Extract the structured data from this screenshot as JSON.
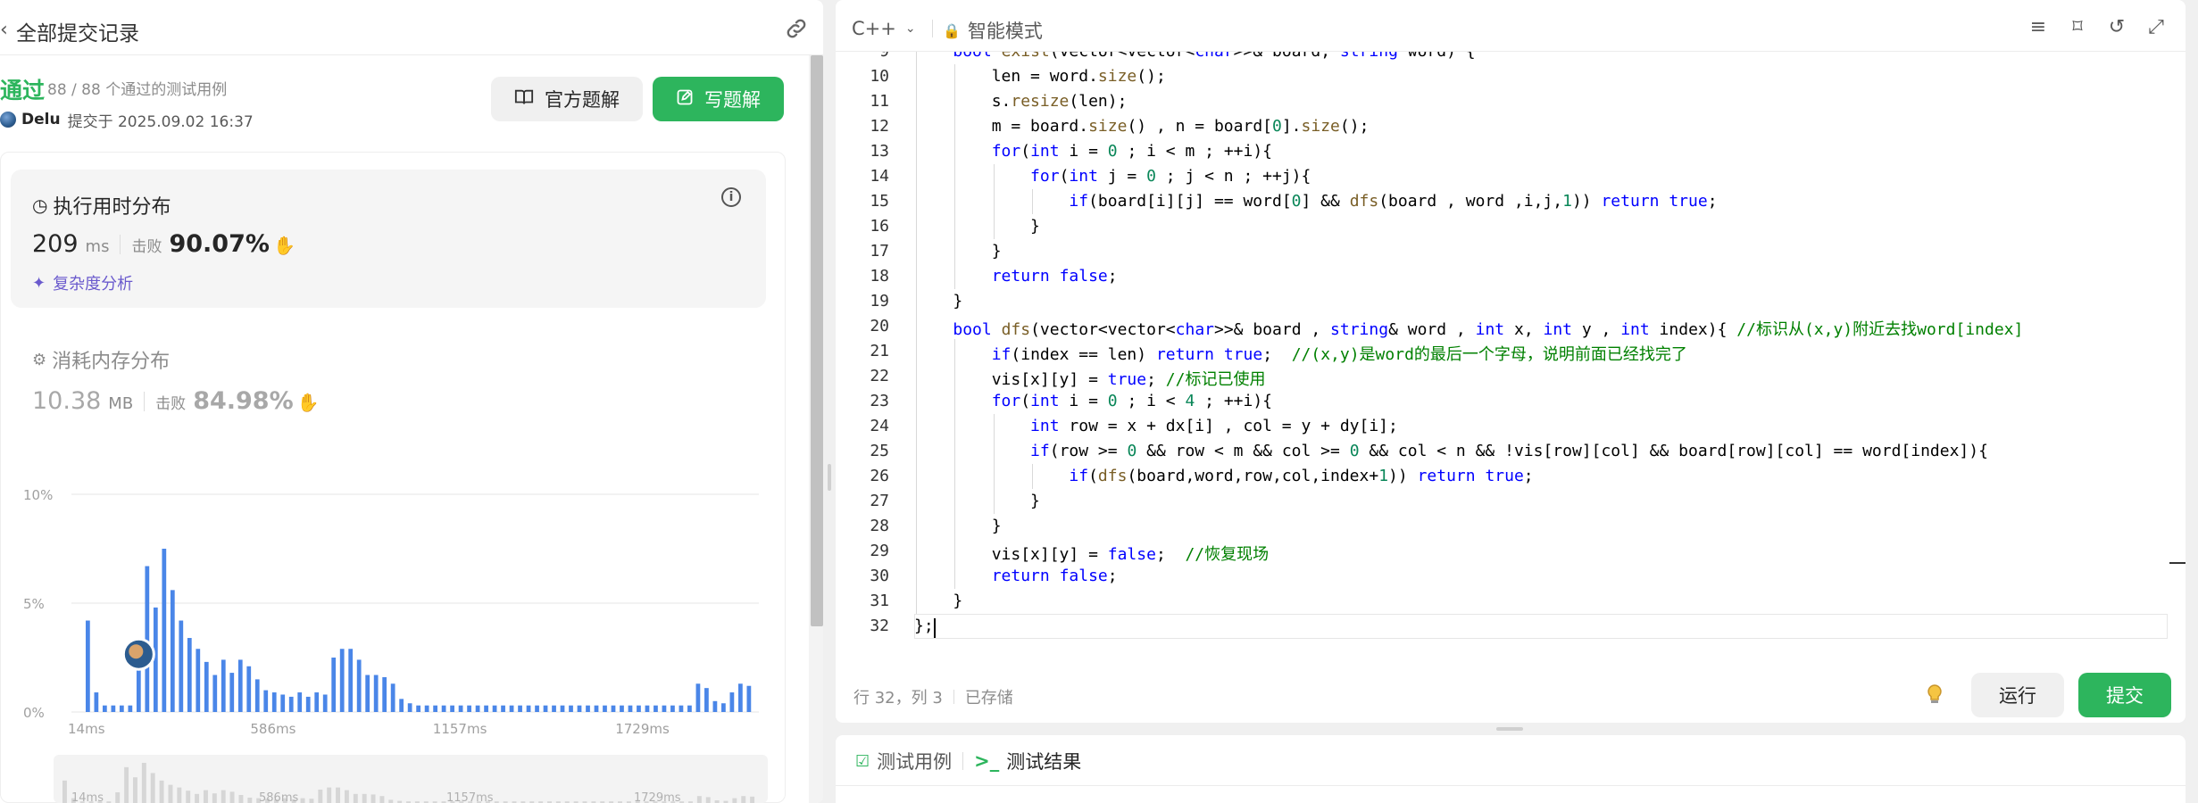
{
  "left": {
    "header_title": "全部提交记录",
    "status": "通过",
    "passed_meta": "88 / 88 个通过的测试用例",
    "user": "Delu",
    "submitted_at": "提交于 2025.09.02 16:37",
    "btn_official": "官方题解",
    "btn_write": "写题解",
    "runtime": {
      "title": "执行用时分布",
      "value": "209",
      "unit": "ms",
      "beat_label": "击败",
      "beat": "90.07%",
      "complexity_link": "复杂度分析"
    },
    "memory": {
      "title": "消耗内存分布",
      "value": "10.38",
      "unit": "MB",
      "beat_label": "击败",
      "beat": "84.98%"
    }
  },
  "chart_data": {
    "type": "bar",
    "title": "",
    "xlabel": "",
    "ylabel": "",
    "ylim": [
      0,
      10
    ],
    "y_ticks": [
      "0%",
      "5%",
      "10%"
    ],
    "x_ticks": [
      "14ms",
      "586ms",
      "1157ms",
      "1729ms"
    ],
    "highlight_index": 6,
    "values": [
      4.2,
      0.9,
      0.3,
      0.3,
      0.3,
      0.3,
      2.0,
      6.7,
      4.8,
      7.5,
      5.6,
      4.2,
      3.4,
      2.9,
      2.3,
      1.7,
      2.4,
      1.8,
      2.4,
      2.1,
      1.5,
      1.0,
      0.9,
      0.8,
      0.7,
      0.9,
      0.7,
      0.9,
      0.8,
      2.5,
      2.9,
      2.9,
      2.4,
      1.7,
      1.7,
      1.6,
      1.3,
      0.6,
      0.4,
      0.3,
      0.3,
      0.3,
      0.3,
      0.3,
      0.3,
      0.3,
      0.3,
      0.3,
      0.3,
      0.3,
      0.3,
      0.3,
      0.3,
      0.3,
      0.3,
      0.3,
      0.3,
      0.3,
      0.3,
      0.3,
      0.3,
      0.3,
      0.3,
      0.3,
      0.3,
      0.3,
      0.3,
      0.3,
      0.3,
      0.3,
      0.3,
      0.3,
      1.3,
      1.1,
      0.5,
      0.4,
      0.9,
      1.3,
      1.2
    ]
  },
  "editor": {
    "language": "C++",
    "mode": "智能模式",
    "first_line": 9,
    "lines": [
      [
        [
          "    "
        ],
        [
          "bool",
          "tp"
        ],
        [
          " "
        ],
        [
          "exist",
          "fn"
        ],
        [
          "(vector<vector<"
        ],
        [
          "char",
          "tp"
        ],
        [
          ">>& board, "
        ],
        [
          "string",
          "tp"
        ],
        [
          " word) {"
        ]
      ],
      [
        [
          "        len = word."
        ],
        [
          "size",
          "fn"
        ],
        [
          "();"
        ]
      ],
      [
        [
          "        s."
        ],
        [
          "resize",
          "fn"
        ],
        [
          "(len);"
        ]
      ],
      [
        [
          "        m = board."
        ],
        [
          "size",
          "fn"
        ],
        [
          "() , n = board["
        ],
        [
          "0",
          "num"
        ],
        [
          "]."
        ],
        [
          "size",
          "fn"
        ],
        [
          "();"
        ]
      ],
      [
        [
          "        "
        ],
        [
          "for",
          "kw"
        ],
        [
          "("
        ],
        [
          "int",
          "tp"
        ],
        [
          " i = "
        ],
        [
          "0",
          "num"
        ],
        [
          " ; i < m ; ++i){"
        ]
      ],
      [
        [
          "            "
        ],
        [
          "for",
          "kw"
        ],
        [
          "("
        ],
        [
          "int",
          "tp"
        ],
        [
          " j = "
        ],
        [
          "0",
          "num"
        ],
        [
          " ; j < n ; ++j){"
        ]
      ],
      [
        [
          "                "
        ],
        [
          "if",
          "kw"
        ],
        [
          "(board[i][j] == word["
        ],
        [
          "0",
          "num"
        ],
        [
          "] && "
        ],
        [
          "dfs",
          "fn"
        ],
        [
          "(board , word ,i,j,"
        ],
        [
          "1",
          "num"
        ],
        [
          ")) "
        ],
        [
          "return",
          "kw"
        ],
        [
          " "
        ],
        [
          "true",
          "kw"
        ],
        [
          ";"
        ]
      ],
      [
        [
          "            }"
        ]
      ],
      [
        [
          "        }"
        ]
      ],
      [
        [
          "        "
        ],
        [
          "return",
          "kw"
        ],
        [
          " "
        ],
        [
          "false",
          "kw"
        ],
        [
          ";"
        ]
      ],
      [
        [
          "    }"
        ]
      ],
      [
        [
          "    "
        ],
        [
          "bool",
          "tp"
        ],
        [
          " "
        ],
        [
          "dfs",
          "fn"
        ],
        [
          "(vector<vector<"
        ],
        [
          "char",
          "tp"
        ],
        [
          ">>& board , "
        ],
        [
          "string",
          "tp"
        ],
        [
          "& word , "
        ],
        [
          "int",
          "tp"
        ],
        [
          " x, "
        ],
        [
          "int",
          "tp"
        ],
        [
          " y , "
        ],
        [
          "int",
          "tp"
        ],
        [
          " index){ "
        ],
        [
          "//标识从(x,y)附近去找word[index]",
          "cm"
        ]
      ],
      [
        [
          "        "
        ],
        [
          "if",
          "kw"
        ],
        [
          "(index == len) "
        ],
        [
          "return",
          "kw"
        ],
        [
          " "
        ],
        [
          "true",
          "kw"
        ],
        [
          ";  "
        ],
        [
          "//(x,y)是word的最后一个字母，说明前面已经找完了",
          "cm"
        ]
      ],
      [
        [
          "        vis[x][y] = "
        ],
        [
          "true",
          "kw"
        ],
        [
          "; "
        ],
        [
          "//标记已使用",
          "cm"
        ]
      ],
      [
        [
          "        "
        ],
        [
          "for",
          "kw"
        ],
        [
          "("
        ],
        [
          "int",
          "tp"
        ],
        [
          " i = "
        ],
        [
          "0",
          "num"
        ],
        [
          " ; i < "
        ],
        [
          "4",
          "num"
        ],
        [
          " ; ++i){"
        ]
      ],
      [
        [
          "            "
        ],
        [
          "int",
          "tp"
        ],
        [
          " row = x + dx[i] , col = y + dy[i];"
        ]
      ],
      [
        [
          "            "
        ],
        [
          "if",
          "kw"
        ],
        [
          "(row >= "
        ],
        [
          "0",
          "num"
        ],
        [
          " && row < m && col >= "
        ],
        [
          "0",
          "num"
        ],
        [
          " && col < n && !vis[row][col] && board[row][col] == word[index]){"
        ]
      ],
      [
        [
          "                "
        ],
        [
          "if",
          "kw"
        ],
        [
          "("
        ],
        [
          "dfs",
          "fn"
        ],
        [
          "(board,word,row,col,index+"
        ],
        [
          "1",
          "num"
        ],
        [
          ")) "
        ],
        [
          "return",
          "kw"
        ],
        [
          " "
        ],
        [
          "true",
          "kw"
        ],
        [
          ";"
        ]
      ],
      [
        [
          "            }"
        ]
      ],
      [
        [
          "        }"
        ]
      ],
      [
        [
          "        vis[x][y] = "
        ],
        [
          "false",
          "kw"
        ],
        [
          ";  "
        ],
        [
          "//恢复现场",
          "cm"
        ]
      ],
      [
        [
          "        "
        ],
        [
          "return",
          "kw"
        ],
        [
          " "
        ],
        [
          "false",
          "kw"
        ],
        [
          ";"
        ]
      ],
      [
        [
          "    }"
        ]
      ],
      [
        [
          "};"
        ]
      ]
    ],
    "cursor_pos": "行 32，列 3",
    "saved_status": "已存储",
    "btn_run": "运行",
    "btn_submit": "提交"
  },
  "test_panel": {
    "tab_case": "测试用例",
    "tab_result": "测试结果"
  }
}
